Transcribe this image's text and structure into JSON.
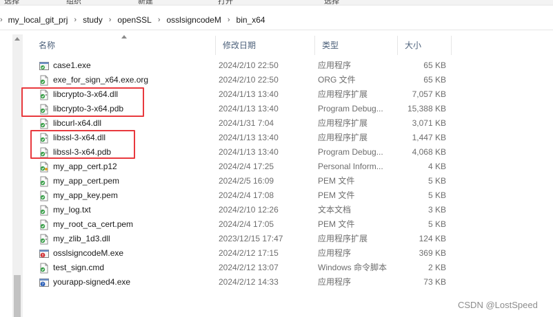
{
  "top_fragments": [
    "选择",
    "组织",
    "新建",
    "打开",
    "选择"
  ],
  "breadcrumb": {
    "items": [
      "my_local_git_prj",
      "study",
      "openSSL",
      "osslsigncodeM",
      "bin_x64"
    ]
  },
  "columns": {
    "name": "名称",
    "date": "修改日期",
    "type": "类型",
    "size": "大小"
  },
  "files": [
    {
      "name": "case1.exe",
      "date": "2024/2/10 22:50",
      "type": "应用程序",
      "size": "65 KB",
      "icon": "exe-icon"
    },
    {
      "name": "exe_for_sign_x64.exe.org",
      "date": "2024/2/10 22:50",
      "type": "ORG 文件",
      "size": "65 KB",
      "icon": "file-icon"
    },
    {
      "name": "libcrypto-3-x64.dll",
      "date": "2024/1/13 13:40",
      "type": "应用程序扩展",
      "size": "7,057 KB",
      "icon": "dll-icon"
    },
    {
      "name": "libcrypto-3-x64.pdb",
      "date": "2024/1/13 13:40",
      "type": "Program Debug...",
      "size": "15,388 KB",
      "icon": "pdb-icon"
    },
    {
      "name": "libcurl-x64.dll",
      "date": "2024/1/31 7:04",
      "type": "应用程序扩展",
      "size": "3,071 KB",
      "icon": "dll-icon"
    },
    {
      "name": "libssl-3-x64.dll",
      "date": "2024/1/13 13:40",
      "type": "应用程序扩展",
      "size": "1,447 KB",
      "icon": "dll-icon"
    },
    {
      "name": "libssl-3-x64.pdb",
      "date": "2024/1/13 13:40",
      "type": "Program Debug...",
      "size": "4,068 KB",
      "icon": "pdb-icon"
    },
    {
      "name": "my_app_cert.p12",
      "date": "2024/2/4 17:25",
      "type": "Personal Inform...",
      "size": "4 KB",
      "icon": "cert-icon"
    },
    {
      "name": "my_app_cert.pem",
      "date": "2024/2/5 16:09",
      "type": "PEM 文件",
      "size": "5 KB",
      "icon": "file-icon"
    },
    {
      "name": "my_app_key.pem",
      "date": "2024/2/4 17:08",
      "type": "PEM 文件",
      "size": "5 KB",
      "icon": "file-icon"
    },
    {
      "name": "my_log.txt",
      "date": "2024/2/10 12:26",
      "type": "文本文档",
      "size": "3 KB",
      "icon": "file-icon"
    },
    {
      "name": "my_root_ca_cert.pem",
      "date": "2024/2/4 17:05",
      "type": "PEM 文件",
      "size": "5 KB",
      "icon": "file-icon"
    },
    {
      "name": "my_zlib_1d3.dll",
      "date": "2023/12/15 17:47",
      "type": "应用程序扩展",
      "size": "124 KB",
      "icon": "dll-icon"
    },
    {
      "name": "osslsigncodeM.exe",
      "date": "2024/2/12 17:15",
      "type": "应用程序",
      "size": "369 KB",
      "icon": "exe-red-icon"
    },
    {
      "name": "test_sign.cmd",
      "date": "2024/2/12 13:07",
      "type": "Windows 命令脚本",
      "size": "2 KB",
      "icon": "file-icon"
    },
    {
      "name": "yourapp-signed4.exe",
      "date": "2024/2/12 14:33",
      "type": "应用程序",
      "size": "73 KB",
      "icon": "exe-blue-icon"
    }
  ],
  "watermark": "CSDN @LostSpeed",
  "colors": {
    "highlight": "#e8383d",
    "header_text": "#4c607a",
    "muted_text": "#6d6d6d"
  }
}
